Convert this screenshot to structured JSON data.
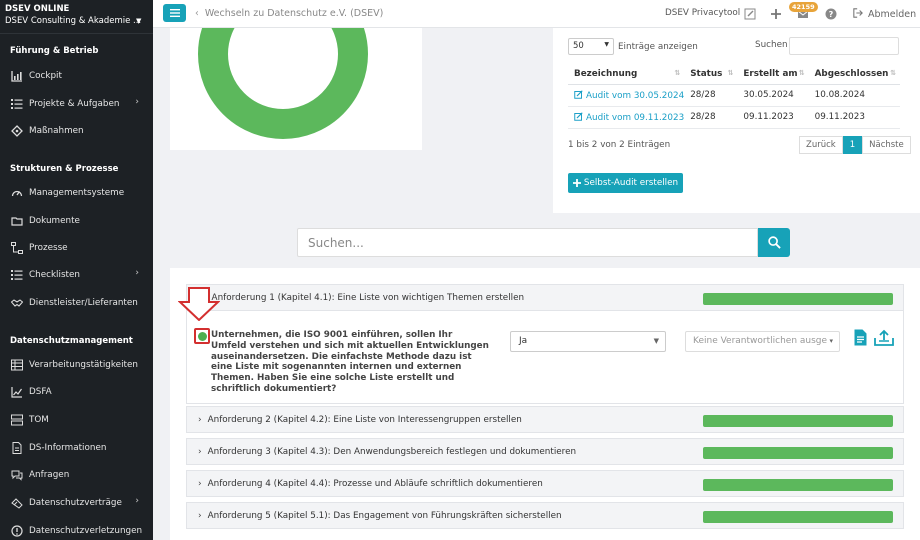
{
  "sidebar": {
    "org_title": "DSEV ONLINE",
    "org_name": "DSEV Consulting & Akademie ...",
    "sections": [
      {
        "title": "Führung & Betrieb"
      },
      {
        "title": "Strukturen & Prozesse"
      },
      {
        "title": "Datenschutzmanagement"
      }
    ],
    "items": [
      {
        "label": "Cockpit",
        "icon": "chart-icon"
      },
      {
        "label": "Projekte & Aufgaben",
        "icon": "list-icon",
        "has_children": true
      },
      {
        "label": "Maßnahmen",
        "icon": "diamond-icon"
      },
      {
        "label": "Managementsysteme",
        "icon": "gauge-icon"
      },
      {
        "label": "Dokumente",
        "icon": "folder-icon"
      },
      {
        "label": "Prozesse",
        "icon": "process-icon"
      },
      {
        "label": "Checklisten",
        "icon": "list-icon",
        "has_children": true
      },
      {
        "label": "Dienstleister/Lieferanten",
        "icon": "handshake-icon"
      },
      {
        "label": "Verarbeitungstätigkeiten",
        "icon": "table-icon"
      },
      {
        "label": "DSFA",
        "icon": "chart-line-icon"
      },
      {
        "label": "TOM",
        "icon": "server-icon"
      },
      {
        "label": "DS-Informationen",
        "icon": "file-icon"
      },
      {
        "label": "Anfragen",
        "icon": "chat-icon"
      },
      {
        "label": "Datenschutzverträge",
        "icon": "contract-icon",
        "has_children": true
      },
      {
        "label": "Datenschutzverletzungen",
        "icon": "alert-icon"
      }
    ]
  },
  "topbar": {
    "back_label": "Wechseln zu Datenschutz e.V. (DSEV)",
    "tool_name": "DSEV Privacytool",
    "badge_count": "42159",
    "logout_label": "Abmelden"
  },
  "audits": {
    "page_size": "50",
    "entries_label": "Einträge anzeigen",
    "search_label": "Suchen",
    "columns": [
      "Bezeichnung",
      "Status",
      "Erstellt am",
      "Abgeschlossen"
    ],
    "rows": [
      {
        "name": "Audit vom 30.05.2024",
        "status": "28/28",
        "created": "30.05.2024",
        "closed": "10.08.2024"
      },
      {
        "name": "Audit vom 09.11.2023",
        "status": "28/28",
        "created": "09.11.2023",
        "closed": "09.11.2023"
      }
    ],
    "info": "1 bis 2 von 2 Einträgen",
    "prev": "Zurück",
    "page": "1",
    "next": "Nächste",
    "create_button": "Selbst-Audit erstellen"
  },
  "main_search": {
    "placeholder": "Suchen..."
  },
  "donut": {
    "color": "#5cb85c"
  },
  "requirements": [
    {
      "title": "Anforderung 1 (Kapitel 4.1): Eine Liste von wichtigen Themen erstellen",
      "expanded": true,
      "progress": 1.0
    },
    {
      "title": "Anforderung 2 (Kapitel 4.2): Eine Liste von Interessengruppen erstellen",
      "progress": 1.0
    },
    {
      "title": "Anforderung 3 (Kapitel 4.3): Den Anwendungsbereich festlegen und dokumentieren",
      "progress": 1.0
    },
    {
      "title": "Anforderung 4 (Kapitel 4.4): Prozesse und Abläufe schriftlich dokumentieren",
      "progress": 1.0
    },
    {
      "title": "Anforderung 5 (Kapitel 5.1): Das Engagement von Führungskräften sicherstellen",
      "progress": 1.0
    }
  ],
  "question": {
    "text": "Unternehmen, die ISO 9001 einführen, sollen Ihr Umfeld verstehen und sich mit aktuellen Entwicklungen auseinandersetzen. Die einfachste Methode dazu ist eine Liste mit sogenannten internen und externen Themen. Haben Sie eine solche Liste erstellt und schriftlich dokumentiert?",
    "answer": "Ja",
    "responsible_placeholder": "Keine Verantwortlichen ausge"
  }
}
